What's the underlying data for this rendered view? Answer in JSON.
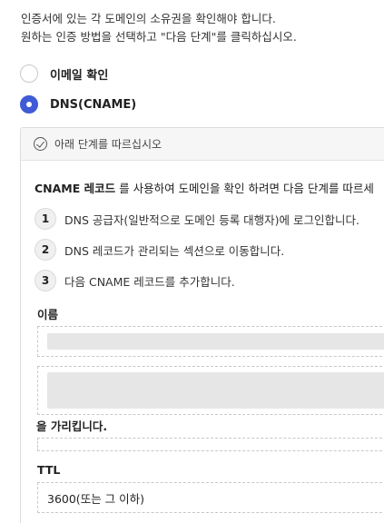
{
  "intro": {
    "line1": "인증서에 있는 각 도메인의 소유권을 확인해야 합니다.",
    "line2": "원하는 인증 방법을 선택하고 \"다음 단계\"를 클릭하십시오."
  },
  "methods": [
    {
      "label": "이메일 확인",
      "selected": false
    },
    {
      "label": "DNS(CNAME)",
      "selected": true
    }
  ],
  "panel": {
    "header": "아래 단계를 따르십시오",
    "description_bold": "CNAME 레코드",
    "description_rest": " 를 사용하여 도메인을 확인 하려면 다음 단계를 따르세",
    "steps": [
      {
        "num": "1",
        "text": "DNS 공급자(일반적으로 도메인 등록 대행자)에 로그인합니다."
      },
      {
        "num": "2",
        "text": "DNS 레코드가 관리되는 섹션으로 이동합니다."
      },
      {
        "num": "3",
        "text": "다음 CNAME 레코드를 추가합니다."
      }
    ],
    "name_label": "이름",
    "points_to_label": "을 가리킵니다.",
    "ttl_label": "TTL",
    "ttl_value": "3600(또는 그 이하)"
  }
}
